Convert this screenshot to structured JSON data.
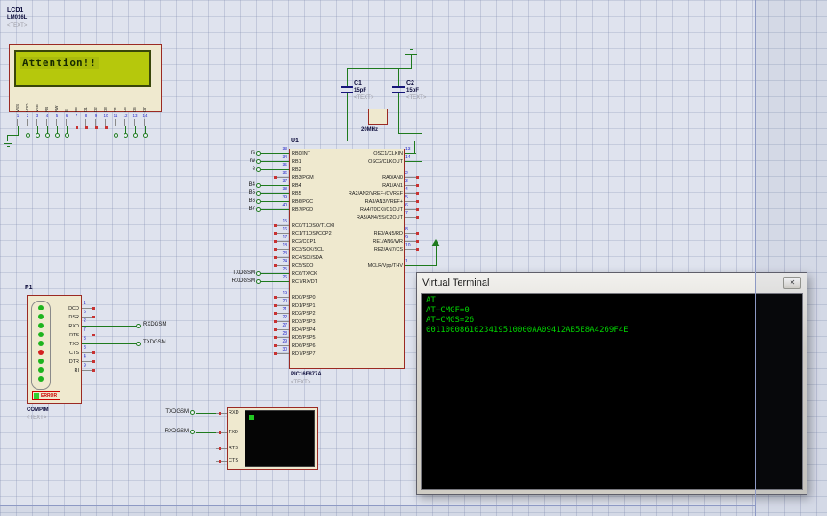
{
  "colors": {
    "wire_green": "#1e7a1e",
    "component_fill": "#efe9cf",
    "component_border": "#9b2a23",
    "lcd_screen_green": "#b6c80c",
    "terminal_text_green": "#00d400",
    "pin_number_blue": "#2626c8"
  },
  "lcd": {
    "ref": "LCD1",
    "part": "LM016L",
    "placeholder": "<TEXT>",
    "display_text": "Attention!!",
    "pins": [
      {
        "num": "1",
        "label": "VSS"
      },
      {
        "num": "2",
        "label": "VDD"
      },
      {
        "num": "3",
        "label": "VEE"
      },
      {
        "num": "4",
        "label": "RS"
      },
      {
        "num": "5",
        "label": "RW"
      },
      {
        "num": "6",
        "label": "E"
      },
      {
        "num": "7",
        "label": "D0"
      },
      {
        "num": "8",
        "label": "D1"
      },
      {
        "num": "9",
        "label": "D2"
      },
      {
        "num": "10",
        "label": "D3"
      },
      {
        "num": "11",
        "label": "D4"
      },
      {
        "num": "12",
        "label": "D5"
      },
      {
        "num": "13",
        "label": "D6"
      },
      {
        "num": "14",
        "label": "D7"
      }
    ]
  },
  "mcu": {
    "ref": "U1",
    "part": "PIC16F877A",
    "placeholder": "<TEXT>",
    "rb_pins": [
      {
        "num": "33",
        "label": "RB0/INT",
        "net": "rs"
      },
      {
        "num": "34",
        "label": "RB1",
        "net": "rw"
      },
      {
        "num": "35",
        "label": "RB2",
        "net": "e"
      },
      {
        "num": "36",
        "label": "RB3/PGM",
        "net": ""
      },
      {
        "num": "37",
        "label": "RB4",
        "net": "B4"
      },
      {
        "num": "38",
        "label": "RB5",
        "net": "B5"
      },
      {
        "num": "39",
        "label": "RB6/PGC",
        "net": "B6"
      },
      {
        "num": "40",
        "label": "RB7/PGD",
        "net": "B7"
      }
    ],
    "rc_pins": [
      {
        "num": "15",
        "label": "RC0/T1OSO/T1CKI",
        "net": ""
      },
      {
        "num": "16",
        "label": "RC1/T1OSI/CCP2",
        "net": ""
      },
      {
        "num": "17",
        "label": "RC2/CCP1",
        "net": ""
      },
      {
        "num": "18",
        "label": "RC3/SCK/SCL",
        "net": ""
      },
      {
        "num": "23",
        "label": "RC4/SDI/SDA",
        "net": ""
      },
      {
        "num": "24",
        "label": "RC5/SDO",
        "net": ""
      },
      {
        "num": "25",
        "label": "RC6/TX/CK",
        "net": "TXDGSM"
      },
      {
        "num": "26",
        "label": "RC7/RX/DT",
        "net": "RXDGSM"
      }
    ],
    "rd_pins": [
      {
        "num": "19",
        "label": "RD0/PSP0",
        "net": ""
      },
      {
        "num": "20",
        "label": "RD1/PSP1",
        "net": ""
      },
      {
        "num": "21",
        "label": "RD2/PSP2",
        "net": ""
      },
      {
        "num": "22",
        "label": "RD3/PSP3",
        "net": ""
      },
      {
        "num": "27",
        "label": "RD4/PSP4",
        "net": ""
      },
      {
        "num": "28",
        "label": "RD5/PSP5",
        "net": ""
      },
      {
        "num": "29",
        "label": "RD6/PSP6",
        "net": ""
      },
      {
        "num": "30",
        "label": "RD7/PSP7",
        "net": ""
      }
    ],
    "osc_pins": [
      {
        "num": "13",
        "label": "OSC1/CLKIN"
      },
      {
        "num": "14",
        "label": "OSC2/CLKOUT"
      }
    ],
    "ra_pins": [
      {
        "num": "2",
        "label": "RA0/AN0"
      },
      {
        "num": "3",
        "label": "RA1/AN1"
      },
      {
        "num": "4",
        "label": "RA2/AN2/VREF-/CVREF"
      },
      {
        "num": "5",
        "label": "RA3/AN3/VREF+"
      },
      {
        "num": "6",
        "label": "RA4/T0CKI/C1OUT"
      },
      {
        "num": "7",
        "label": "RA5/AN4/SS/C2OUT"
      }
    ],
    "re_pins": [
      {
        "num": "8",
        "label": "RE0/AN5/RD"
      },
      {
        "num": "9",
        "label": "RE1/AN6/WR"
      },
      {
        "num": "10",
        "label": "RE2/AN7/CS"
      }
    ],
    "mclr_pins": [
      {
        "num": "1",
        "label": "MCLR/Vpp/THV"
      }
    ]
  },
  "crystal_circuit": {
    "c1_ref": "C1",
    "c1_value": "15pF",
    "c1_placeholder": "<TEXT>",
    "c2_ref": "C2",
    "c2_value": "15pF",
    "c2_placeholder": "<TEXT>",
    "xtal_value": "20MHz"
  },
  "compim": {
    "ref": "P1",
    "part": "COMPIM",
    "placeholder": "<TEXT>",
    "error_label": "ERROR",
    "pins": [
      {
        "num": "1",
        "label": "DCD"
      },
      {
        "num": "6",
        "label": "DSR"
      },
      {
        "num": "2",
        "label": "RXD"
      },
      {
        "num": "7",
        "label": "RTS"
      },
      {
        "num": "3",
        "label": "TXD"
      },
      {
        "num": "8",
        "label": "CTS"
      },
      {
        "num": "4",
        "label": "DTR"
      },
      {
        "num": "9",
        "label": "RI"
      }
    ]
  },
  "gsm": {
    "pins": [
      "RXD",
      "TXD",
      "RTS",
      "CTS"
    ]
  },
  "nets": {
    "txdgsm": "TXDGSM",
    "rxdgsm": "RXDGSM"
  },
  "terminal": {
    "title": "Virtual Terminal",
    "close_glyph": "✕",
    "lines": [
      "AT",
      "AT+CMGF=0",
      "AT+CMGS=26",
      "0011000861023419510000AA09412AB5E8A4269F4E"
    ]
  }
}
